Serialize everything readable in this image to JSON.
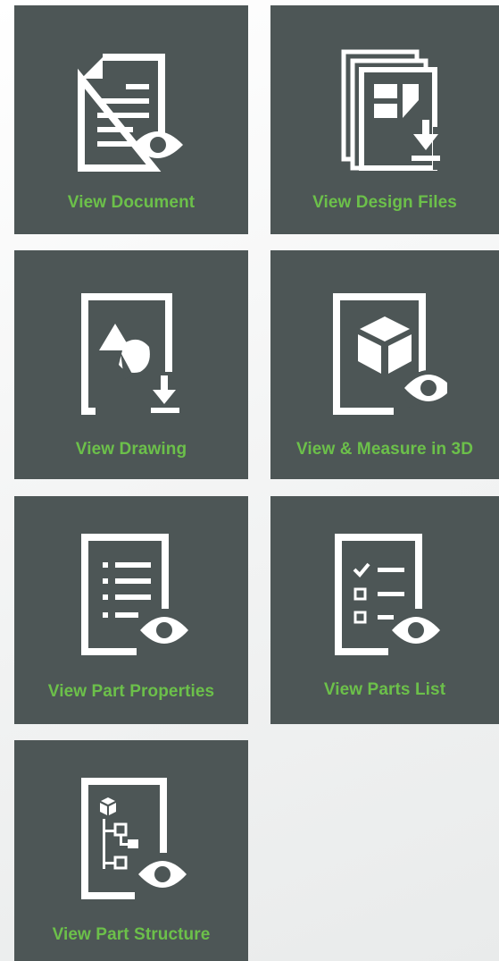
{
  "tiles": [
    {
      "label": "View Document",
      "icon": "document-view-icon"
    },
    {
      "label": "View Design Files",
      "icon": "design-files-download-icon"
    },
    {
      "label": "View Drawing",
      "icon": "drawing-download-icon"
    },
    {
      "label": "View & Measure in 3D",
      "icon": "cube-3d-view-icon"
    },
    {
      "label": "View Part Properties",
      "icon": "part-properties-view-icon"
    },
    {
      "label": "View Parts List",
      "icon": "parts-list-view-icon"
    },
    {
      "label": "View Part Structure",
      "icon": "part-structure-view-icon"
    }
  ],
  "colors": {
    "tile_background": "#4d5656",
    "label_green": "#6cc04a",
    "icon_white": "#ffffff"
  }
}
